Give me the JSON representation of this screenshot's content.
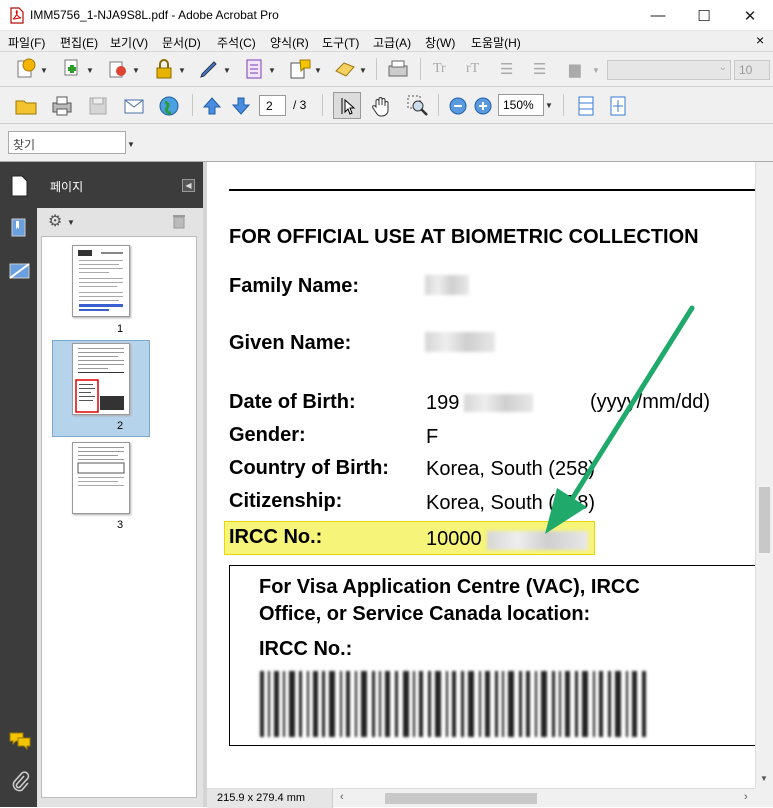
{
  "window": {
    "title": "IMM5756_1-NJA9S8L.pdf - Adobe Acrobat Pro",
    "minimize": "—",
    "maximize": "☐",
    "close": "✕"
  },
  "menu": {
    "items": [
      "파일(F)",
      "편집(E)",
      "보기(V)",
      "문서(D)",
      "주석(C)",
      "양식(R)",
      "도구(T)",
      "고급(A)",
      "창(W)",
      "도움말(H)"
    ],
    "close_doc": "×"
  },
  "toolbar2": {
    "page_current": "2",
    "page_total": "/ 3",
    "zoom": "150%"
  },
  "toolbar1": {
    "font_size": "10"
  },
  "search": {
    "placeholder": "찾기"
  },
  "sidebar": {
    "panel_title": "페이지",
    "pages": [
      "1",
      "2",
      "3"
    ],
    "selected_page": 2
  },
  "document": {
    "heading": "FOR OFFICIAL USE AT BIOMETRIC COLLECTION",
    "family_name_label": "Family Name:",
    "given_name_label": "Given Name:",
    "dob_label": "Date of Birth:",
    "dob_value": "199",
    "dob_format": "(yyyy/mm/dd)",
    "gender_label": "Gender:",
    "gender_value": "F",
    "country_label": "Country of Birth:",
    "country_value": "Korea, South (258)",
    "citizenship_label": "Citizenship:",
    "citizenship_value": "Korea, South (258)",
    "ircc_label": "IRCC No.:",
    "ircc_value": "10000",
    "box_title_line1": "For Visa Application Centre (VAC), IRCC",
    "box_title_line2": "Office, or Service Canada location:",
    "box_ircc_label": "IRCC No.:"
  },
  "status": {
    "page_size": "215.9 x 279.4 mm"
  },
  "colors": {
    "highlight": "#f7f47a",
    "highlight_border": "#e6d800",
    "arrow": "#1faa6b",
    "sidebar_dark": "#3c3c3c",
    "thumb_selected": "#b6d3ec"
  }
}
